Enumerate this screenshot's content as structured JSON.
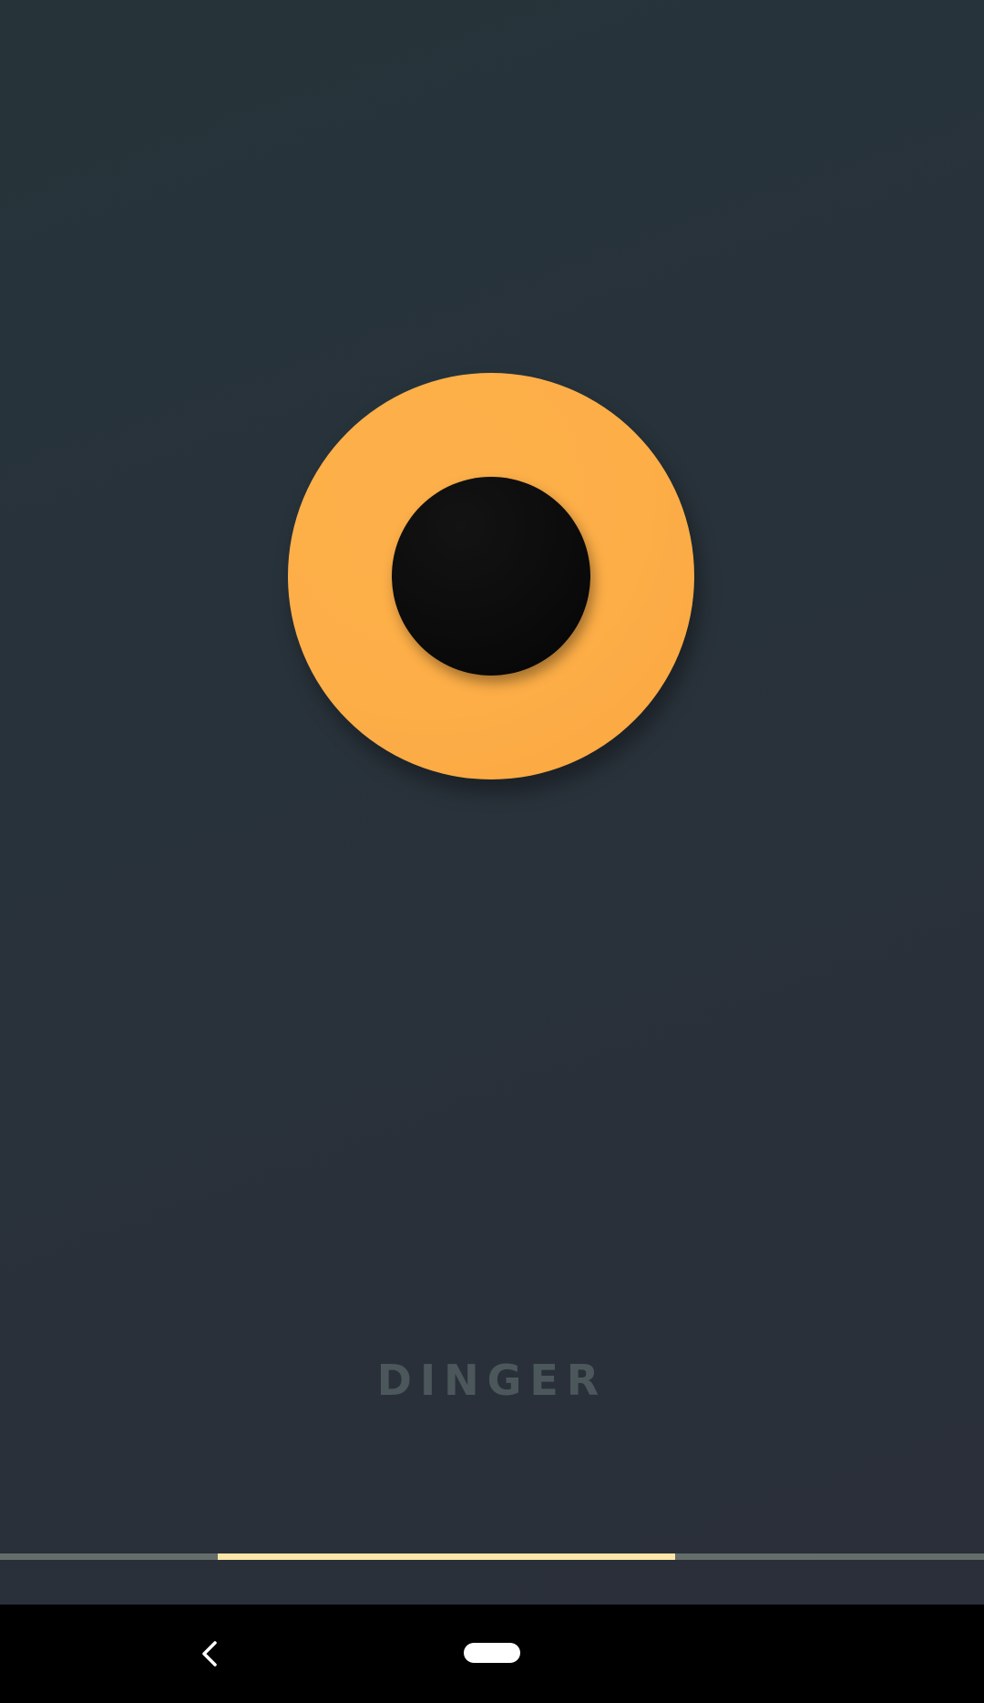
{
  "splash": {
    "app_name": "DINGER",
    "logo_icon": "dinger-logo-icon",
    "logo_color": "#fdae47",
    "logo_center_color": "#0b0b0b",
    "background_color": "#28323a",
    "app_name_color": "#4c575c"
  },
  "loading": {
    "progress": 0.387,
    "track_color": "#646d6a",
    "fill_color": "#fce7a8"
  },
  "nav_bar": {
    "back_icon": "chevron-left-icon",
    "home_icon": "home-pill-icon"
  }
}
